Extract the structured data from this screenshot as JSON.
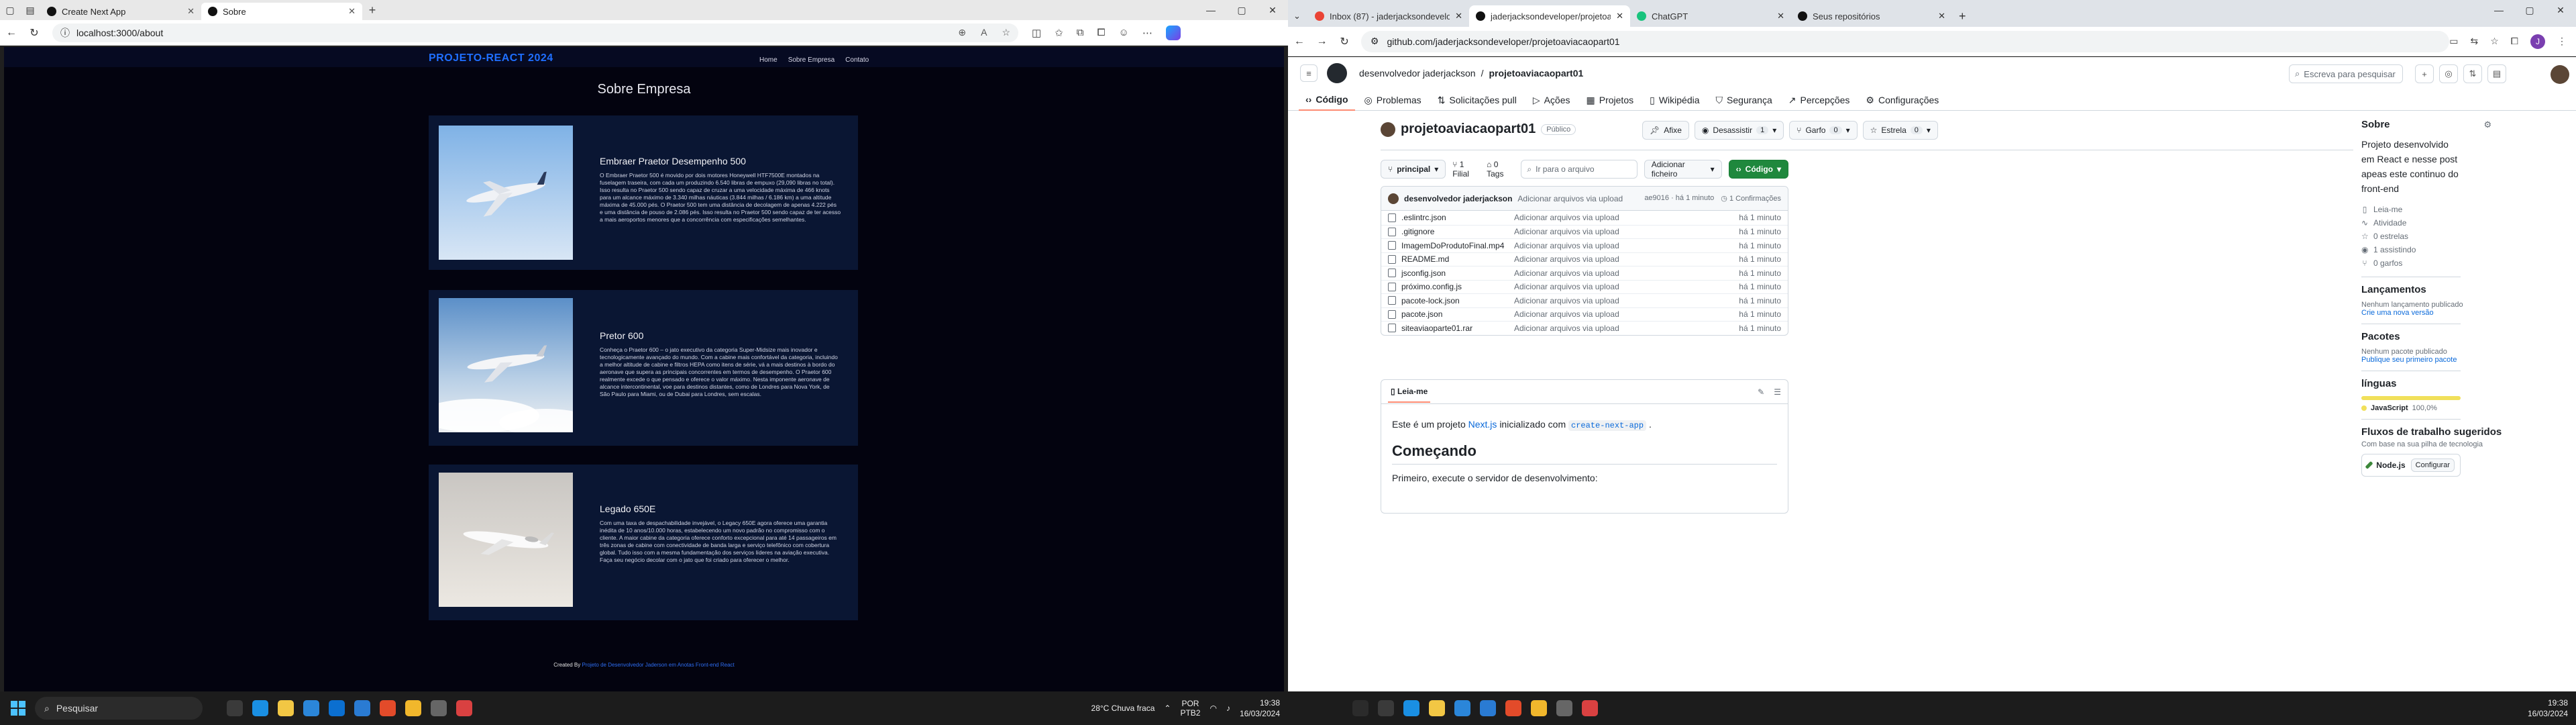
{
  "left_browser": {
    "tabs": [
      {
        "title": "Create Next App",
        "active": false
      },
      {
        "title": "Sobre",
        "active": true
      }
    ],
    "url": "localhost:3000/about"
  },
  "site": {
    "brand": "PROJETO-REACT 2024",
    "nav": [
      "Home",
      "Sobre Empresa",
      "Contato"
    ],
    "page_title": "Sobre Empresa",
    "cards": [
      {
        "title": "Embraer Praetor Desempenho 500",
        "text": "O Embraer Praetor 500 é movido por dois motores Honeywell HTF7500E montados na fuselagem traseira, com cada um produzindo 6.540 libras de empuxo (29,090 libras no total). Isso resulta no Praetor 500 sendo capaz de cruzar a uma velocidade máxima de 466 knots para um alcance máximo de 3.340 milhas náuticas (3.844 milhas / 6.186 km) a uma altitude máxima de 45.000 pés. O Praetor 500 tem uma distância de decolagem de apenas 4.222 pés e uma distância de pouso de 2.086 pés. Isso resulta no Praetor 500 sendo capaz de ter acesso a mais aeroportos menores que a concorrência com especificações semelhantes."
      },
      {
        "title": "Pretor 600",
        "text": "Conheça o Praetor 600 – o jato executivo da categoria Super-Midsize mais inovador e tecnologicamente avançado do mundo. Com a cabine mais confortável da categoria, incluindo a melhor altitude de cabine e filtros HEPA como itens de série, vá a mais destinos à bordo do aeronave que supera as principais concorrentes em termos de desempenho. O Praetor 600 realmente excede o que pensado e oferece o valor máximo. Nesta imponente aeronave de alcance intercontinental, voe para destinos distantes, como de Londres para Nova York, de São Paulo para Miami, ou de Dubai para Londres, sem escalas."
      },
      {
        "title": "Legado 650E",
        "text": "Com uma taxa de despachabilidade invejável, o Legacy 650E agora oferece uma garantia inédita de 10 anos/10.000 horas, estabelecendo um novo padrão no compromisso com o cliente. A maior cabine da categoria oferece conforto excepcional para até 14 passageiros em três zonas de cabine com conectividade de banda larga e serviço telefônico com cobertura global. Tudo isso com a mesma fundamentação dos serviços líderes na aviação executiva. Faça seu negócio decolar com o jato que foi criado para oferecer o melhor."
      }
    ],
    "footer_prefix": "Created By",
    "footer_link": "Projeto de Desenvolvedor Jaderson em Anotas Front-end React"
  },
  "right_browser": {
    "tabs": [
      {
        "title": "Inbox (87) - jaderjacksondevelop",
        "color": "#ea4335"
      },
      {
        "title": "jaderjacksondeveloper/projetoav",
        "color": "#111111",
        "active": true
      },
      {
        "title": "ChatGPT",
        "color": "#19c37d"
      },
      {
        "title": "Seus repositórios",
        "color": "#111111"
      }
    ],
    "url": "github.com/jaderjacksondeveloper/projetoaviacaopart01"
  },
  "github": {
    "owner": "desenvolvedor jaderjackson",
    "repo": "projetoaviacaopart01",
    "search_placeholder": "Escreva para pesquisar",
    "nav": [
      "Código",
      "Problemas",
      "Solicitações pull",
      "Ações",
      "Projetos",
      "Wikipédia",
      "Segurança",
      "Percepções",
      "Configurações"
    ],
    "visibility": "Público",
    "pin": "Afixe",
    "unwatch": "Desassistir",
    "unwatch_count": "1",
    "fork": "Garfo",
    "fork_count": "0",
    "star": "Estrela",
    "star_count": "0",
    "branch": "principal",
    "branches": "1 Filial",
    "tags": "0 Tags",
    "file_search": "Ir para o arquivo",
    "add_file": "Adicionar ficheiro",
    "code_btn": "Código",
    "commit_author": "desenvolvedor jaderjackson",
    "commit_msg": "Adicionar arquivos via upload",
    "commit_hash": "ae9016 · há 1 minuto",
    "commits": "1 Confirmações",
    "files": [
      {
        "name": ".eslintrc.json",
        "msg": "Adicionar arquivos via upload",
        "time": "há 1 minuto"
      },
      {
        "name": ".gitignore",
        "msg": "Adicionar arquivos via upload",
        "time": "há 1 minuto"
      },
      {
        "name": "ImagemDoProdutoFinal.mp4",
        "msg": "Adicionar arquivos via upload",
        "time": "há 1 minuto"
      },
      {
        "name": "README.md",
        "msg": "Adicionar arquivos via upload",
        "time": "há 1 minuto"
      },
      {
        "name": "jsconfig.json",
        "msg": "Adicionar arquivos via upload",
        "time": "há 1 minuto"
      },
      {
        "name": "próximo.config.js",
        "msg": "Adicionar arquivos via upload",
        "time": "há 1 minuto"
      },
      {
        "name": "pacote-lock.json",
        "msg": "Adicionar arquivos via upload",
        "time": "há 1 minuto"
      },
      {
        "name": "pacote.json",
        "msg": "Adicionar arquivos via upload",
        "time": "há 1 minuto"
      },
      {
        "name": "siteaviaoparte01.rar",
        "msg": "Adicionar arquivos via upload",
        "time": "há 1 minuto"
      }
    ],
    "readme_tab": "Leia-me",
    "readme_p1_a": "Este é um projeto",
    "readme_p1_link": "Next.js",
    "readme_p1_b": "inicializado com",
    "readme_p1_code": "create-next-app",
    "readme_h2": "Começando",
    "readme_p2": "Primeiro, execute o servidor de desenvolvimento:",
    "about_title": "Sobre",
    "about_desc": "Projeto desenvolvido em React e nesse post apeas este continuo do front-end",
    "about_items": [
      "Leia-me",
      "Atividade",
      "0 estrelas",
      "1 assistindo",
      "0 garfos"
    ],
    "releases_title": "Lançamentos",
    "releases_none": "Nenhum lançamento publicado",
    "releases_link": "Crie uma nova versão",
    "packages_title": "Pacotes",
    "packages_none": "Nenhum pacote publicado",
    "packages_link": "Publique seu primeiro pacote",
    "languages_title": "línguas",
    "language": "JavaScript",
    "language_pct": "100,0%",
    "language_color": "#f1e05a",
    "workflows_title": "Fluxos de trabalho sugeridos",
    "workflows_sub": "Com base na sua pilha de tecnologia",
    "workflow_name": "Node.js",
    "workflow_btn": "Configurar"
  },
  "taskbar_left": {
    "search": "Pesquisar",
    "weather": "28°C  Chuva fraca",
    "lang": "POR",
    "lang2": "PTB2",
    "time": "19:38",
    "date": "16/03/2024"
  },
  "taskbar_right": {
    "time": "19:38",
    "date": "16/03/2024"
  }
}
